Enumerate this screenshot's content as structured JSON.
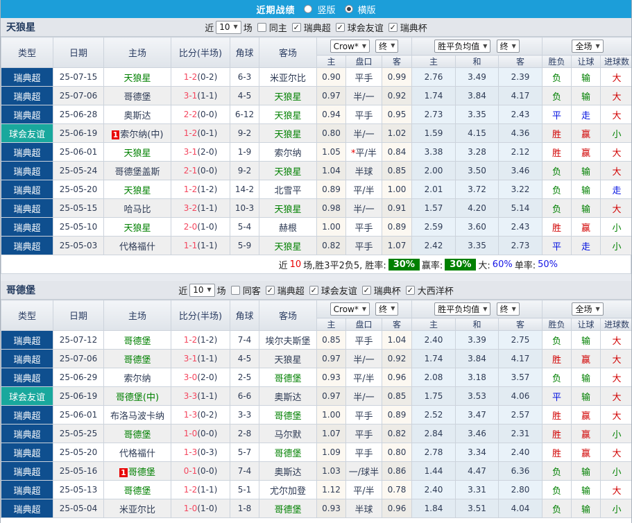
{
  "topbar": {
    "title": "近期战绩",
    "vertical_label": "竖版",
    "horizontal_label": "横版"
  },
  "icons": {
    "dropdown_arrow": "▼",
    "check": "✓"
  },
  "colors": {
    "topbar": "#1c9ed9",
    "league": "#0f4f8f",
    "friendly": "#19a89d",
    "win_red": "#d10000",
    "lose_green": "#008000",
    "draw_blue": "#0010e0",
    "score_red": "#f4465e",
    "badge_green": "#008000",
    "badge_red": "#e80000"
  },
  "sections": [
    {
      "team": "天狼星",
      "filter": {
        "near_label": "近",
        "games_value": "10",
        "games_unit": "场",
        "same_label": "同主",
        "same_checked": false,
        "leagues": [
          {
            "label": "瑞典超",
            "checked": true
          },
          {
            "label": "球会友谊",
            "checked": true
          },
          {
            "label": "瑞典杯",
            "checked": true
          }
        ]
      },
      "header": {
        "col_type": "类型",
        "col_date": "日期",
        "col_home": "主场",
        "col_score": "比分(半场)",
        "col_corner": "角球",
        "col_away": "客场",
        "odds_provider": "Crow*",
        "odds_stage": "终",
        "avg_label": "胜平负均值",
        "avg_stage": "终",
        "full_label": "全场",
        "sub": [
          "主",
          "盘口",
          "客",
          "主",
          "和",
          "客",
          "胜负",
          "让球",
          "进球数"
        ]
      },
      "rows": [
        {
          "type": "瑞典超",
          "friendly": false,
          "date": "25-07-15",
          "badge": "",
          "home": "天狼星",
          "home_hl": true,
          "score": "1-2",
          "half": "(0-2)",
          "corner": "6-3",
          "away": "米亚尔比",
          "away_hl": false,
          "odds_home": "0.90",
          "handicap": "平手",
          "star": "",
          "odds_away": "0.99",
          "avg_home": "2.76",
          "avg_draw": "3.49",
          "avg_away": "2.39",
          "outcome": "负",
          "outcome_c": "g",
          "let_result": "输",
          "let_c": "g",
          "goals": "大",
          "goals_c": "r"
        },
        {
          "type": "瑞典超",
          "friendly": false,
          "date": "25-07-06",
          "badge": "",
          "home": "哥德堡",
          "home_hl": false,
          "score": "3-1",
          "half": "(1-1)",
          "corner": "4-5",
          "away": "天狼星",
          "away_hl": true,
          "odds_home": "0.97",
          "handicap": "半/一",
          "star": "",
          "odds_away": "0.92",
          "avg_home": "1.74",
          "avg_draw": "3.84",
          "avg_away": "4.17",
          "outcome": "负",
          "outcome_c": "g",
          "let_result": "输",
          "let_c": "g",
          "goals": "大",
          "goals_c": "r"
        },
        {
          "type": "瑞典超",
          "friendly": false,
          "date": "25-06-28",
          "badge": "",
          "home": "奥斯达",
          "home_hl": false,
          "score": "2-2",
          "half": "(0-0)",
          "corner": "6-12",
          "away": "天狼星",
          "away_hl": true,
          "odds_home": "0.94",
          "handicap": "平手",
          "star": "",
          "odds_away": "0.95",
          "avg_home": "2.73",
          "avg_draw": "3.35",
          "avg_away": "2.43",
          "outcome": "平",
          "outcome_c": "b",
          "let_result": "走",
          "let_c": "b",
          "goals": "大",
          "goals_c": "r"
        },
        {
          "type": "球会友谊",
          "friendly": true,
          "date": "25-06-19",
          "badge": "1",
          "home": "索尔纳(中)",
          "home_hl": false,
          "score": "1-2",
          "half": "(0-1)",
          "corner": "9-2",
          "away": "天狼星",
          "away_hl": true,
          "odds_home": "0.80",
          "handicap": "半/一",
          "star": "",
          "odds_away": "1.02",
          "avg_home": "1.59",
          "avg_draw": "4.15",
          "avg_away": "4.36",
          "outcome": "胜",
          "outcome_c": "r",
          "let_result": "赢",
          "let_c": "r",
          "goals": "小",
          "goals_c": "g"
        },
        {
          "type": "瑞典超",
          "friendly": false,
          "date": "25-06-01",
          "badge": "",
          "home": "天狼星",
          "home_hl": true,
          "score": "3-1",
          "half": "(2-0)",
          "corner": "1-9",
          "away": "索尔纳",
          "away_hl": false,
          "odds_home": "1.05",
          "handicap": "平/半",
          "star": "*",
          "odds_away": "0.84",
          "avg_home": "3.38",
          "avg_draw": "3.28",
          "avg_away": "2.12",
          "outcome": "胜",
          "outcome_c": "r",
          "let_result": "赢",
          "let_c": "r",
          "goals": "大",
          "goals_c": "r"
        },
        {
          "type": "瑞典超",
          "friendly": false,
          "date": "25-05-24",
          "badge": "",
          "home": "哥德堡盖斯",
          "home_hl": false,
          "score": "2-1",
          "half": "(0-0)",
          "corner": "9-2",
          "away": "天狼星",
          "away_hl": true,
          "odds_home": "1.04",
          "handicap": "半球",
          "star": "",
          "odds_away": "0.85",
          "avg_home": "2.00",
          "avg_draw": "3.50",
          "avg_away": "3.46",
          "outcome": "负",
          "outcome_c": "g",
          "let_result": "输",
          "let_c": "g",
          "goals": "大",
          "goals_c": "r"
        },
        {
          "type": "瑞典超",
          "friendly": false,
          "date": "25-05-20",
          "badge": "",
          "home": "天狼星",
          "home_hl": true,
          "score": "1-2",
          "half": "(1-2)",
          "corner": "14-2",
          "away": "北雪平",
          "away_hl": false,
          "odds_home": "0.89",
          "handicap": "平/半",
          "star": "",
          "odds_away": "1.00",
          "avg_home": "2.01",
          "avg_draw": "3.72",
          "avg_away": "3.22",
          "outcome": "负",
          "outcome_c": "g",
          "let_result": "输",
          "let_c": "g",
          "goals": "走",
          "goals_c": "b"
        },
        {
          "type": "瑞典超",
          "friendly": false,
          "date": "25-05-15",
          "badge": "",
          "home": "哈马比",
          "home_hl": false,
          "score": "3-2",
          "half": "(1-1)",
          "corner": "10-3",
          "away": "天狼星",
          "away_hl": true,
          "odds_home": "0.98",
          "handicap": "半/一",
          "star": "",
          "odds_away": "0.91",
          "avg_home": "1.57",
          "avg_draw": "4.20",
          "avg_away": "5.14",
          "outcome": "负",
          "outcome_c": "g",
          "let_result": "输",
          "let_c": "g",
          "goals": "大",
          "goals_c": "r"
        },
        {
          "type": "瑞典超",
          "friendly": false,
          "date": "25-05-10",
          "badge": "",
          "home": "天狼星",
          "home_hl": true,
          "score": "2-0",
          "half": "(1-0)",
          "corner": "5-4",
          "away": "赫根",
          "away_hl": false,
          "odds_home": "1.00",
          "handicap": "平手",
          "star": "",
          "odds_away": "0.89",
          "avg_home": "2.59",
          "avg_draw": "3.60",
          "avg_away": "2.43",
          "outcome": "胜",
          "outcome_c": "r",
          "let_result": "赢",
          "let_c": "r",
          "goals": "小",
          "goals_c": "g"
        },
        {
          "type": "瑞典超",
          "friendly": false,
          "date": "25-05-03",
          "badge": "",
          "home": "代格福什",
          "home_hl": false,
          "score": "1-1",
          "half": "(1-1)",
          "corner": "5-9",
          "away": "天狼星",
          "away_hl": true,
          "odds_home": "0.82",
          "handicap": "平手",
          "star": "",
          "odds_away": "1.07",
          "avg_home": "2.42",
          "avg_draw": "3.35",
          "avg_away": "2.73",
          "outcome": "平",
          "outcome_c": "b",
          "let_result": "走",
          "let_c": "b",
          "goals": "小",
          "goals_c": "g"
        }
      ],
      "summary": {
        "prefix": "近",
        "games": "10",
        "record": "场,胜3平2负5, 胜率:",
        "win_badge": "30%",
        "profit_label": "赢率:",
        "profit_badge": "30%",
        "big_label": "大:",
        "big_value": "60%",
        "single_label": "单率:",
        "single_value": "50%"
      }
    },
    {
      "team": "哥德堡",
      "filter": {
        "near_label": "近",
        "games_value": "10",
        "games_unit": "场",
        "same_label": "同客",
        "same_checked": false,
        "leagues": [
          {
            "label": "瑞典超",
            "checked": true
          },
          {
            "label": "球会友谊",
            "checked": true
          },
          {
            "label": "瑞典杯",
            "checked": true
          },
          {
            "label": "大西洋杯",
            "checked": true
          }
        ]
      },
      "header": {
        "col_type": "类型",
        "col_date": "日期",
        "col_home": "主场",
        "col_score": "比分(半场)",
        "col_corner": "角球",
        "col_away": "客场",
        "odds_provider": "Crow*",
        "odds_stage": "终",
        "avg_label": "胜平负均值",
        "avg_stage": "终",
        "full_label": "全场",
        "sub": [
          "主",
          "盘口",
          "客",
          "主",
          "和",
          "客",
          "胜负",
          "让球",
          "进球数"
        ]
      },
      "rows": [
        {
          "type": "瑞典超",
          "friendly": false,
          "date": "25-07-12",
          "badge": "",
          "home": "哥德堡",
          "home_hl": true,
          "score": "1-2",
          "half": "(1-2)",
          "corner": "7-4",
          "away": "埃尔夫斯堡",
          "away_hl": false,
          "odds_home": "0.85",
          "handicap": "平手",
          "star": "",
          "odds_away": "1.04",
          "avg_home": "2.40",
          "avg_draw": "3.39",
          "avg_away": "2.75",
          "outcome": "负",
          "outcome_c": "g",
          "let_result": "输",
          "let_c": "g",
          "goals": "大",
          "goals_c": "r"
        },
        {
          "type": "瑞典超",
          "friendly": false,
          "date": "25-07-06",
          "badge": "",
          "home": "哥德堡",
          "home_hl": true,
          "score": "3-1",
          "half": "(1-1)",
          "corner": "4-5",
          "away": "天狼星",
          "away_hl": false,
          "odds_home": "0.97",
          "handicap": "半/一",
          "star": "",
          "odds_away": "0.92",
          "avg_home": "1.74",
          "avg_draw": "3.84",
          "avg_away": "4.17",
          "outcome": "胜",
          "outcome_c": "r",
          "let_result": "赢",
          "let_c": "r",
          "goals": "大",
          "goals_c": "r"
        },
        {
          "type": "瑞典超",
          "friendly": false,
          "date": "25-06-29",
          "badge": "",
          "home": "索尔纳",
          "home_hl": false,
          "score": "3-0",
          "half": "(2-0)",
          "corner": "2-5",
          "away": "哥德堡",
          "away_hl": true,
          "odds_home": "0.93",
          "handicap": "平/半",
          "star": "",
          "odds_away": "0.96",
          "avg_home": "2.08",
          "avg_draw": "3.18",
          "avg_away": "3.57",
          "outcome": "负",
          "outcome_c": "g",
          "let_result": "输",
          "let_c": "g",
          "goals": "大",
          "goals_c": "r"
        },
        {
          "type": "球会友谊",
          "friendly": true,
          "date": "25-06-19",
          "badge": "",
          "home": "哥德堡(中)",
          "home_hl": true,
          "score": "3-3",
          "half": "(1-1)",
          "corner": "6-6",
          "away": "奥斯达",
          "away_hl": false,
          "odds_home": "0.97",
          "handicap": "半/一",
          "star": "",
          "odds_away": "0.85",
          "avg_home": "1.75",
          "avg_draw": "3.53",
          "avg_away": "4.06",
          "outcome": "平",
          "outcome_c": "b",
          "let_result": "输",
          "let_c": "g",
          "goals": "大",
          "goals_c": "r"
        },
        {
          "type": "瑞典超",
          "friendly": false,
          "date": "25-06-01",
          "badge": "",
          "home": "布洛马波卡纳",
          "home_hl": false,
          "score": "1-3",
          "half": "(0-2)",
          "corner": "3-3",
          "away": "哥德堡",
          "away_hl": true,
          "odds_home": "1.00",
          "handicap": "平手",
          "star": "",
          "odds_away": "0.89",
          "avg_home": "2.52",
          "avg_draw": "3.47",
          "avg_away": "2.57",
          "outcome": "胜",
          "outcome_c": "r",
          "let_result": "赢",
          "let_c": "r",
          "goals": "大",
          "goals_c": "r"
        },
        {
          "type": "瑞典超",
          "friendly": false,
          "date": "25-05-25",
          "badge": "",
          "home": "哥德堡",
          "home_hl": true,
          "score": "1-0",
          "half": "(0-0)",
          "corner": "2-8",
          "away": "马尔默",
          "away_hl": false,
          "odds_home": "1.07",
          "handicap": "平手",
          "star": "",
          "odds_away": "0.82",
          "avg_home": "2.84",
          "avg_draw": "3.46",
          "avg_away": "2.31",
          "outcome": "胜",
          "outcome_c": "r",
          "let_result": "赢",
          "let_c": "r",
          "goals": "小",
          "goals_c": "g"
        },
        {
          "type": "瑞典超",
          "friendly": false,
          "date": "25-05-20",
          "badge": "",
          "home": "代格福什",
          "home_hl": false,
          "score": "1-3",
          "half": "(0-3)",
          "corner": "5-7",
          "away": "哥德堡",
          "away_hl": true,
          "odds_home": "1.09",
          "handicap": "平手",
          "star": "",
          "odds_away": "0.80",
          "avg_home": "2.78",
          "avg_draw": "3.34",
          "avg_away": "2.40",
          "outcome": "胜",
          "outcome_c": "r",
          "let_result": "赢",
          "let_c": "r",
          "goals": "大",
          "goals_c": "r"
        },
        {
          "type": "瑞典超",
          "friendly": false,
          "date": "25-05-16",
          "badge": "1",
          "home": "哥德堡",
          "home_hl": true,
          "score": "0-1",
          "half": "(0-0)",
          "corner": "7-4",
          "away": "奥斯达",
          "away_hl": false,
          "odds_home": "1.03",
          "handicap": "一/球半",
          "star": "",
          "odds_away": "0.86",
          "avg_home": "1.44",
          "avg_draw": "4.47",
          "avg_away": "6.36",
          "outcome": "负",
          "outcome_c": "g",
          "let_result": "输",
          "let_c": "g",
          "goals": "小",
          "goals_c": "g"
        },
        {
          "type": "瑞典超",
          "friendly": false,
          "date": "25-05-13",
          "badge": "",
          "home": "哥德堡",
          "home_hl": true,
          "score": "1-2",
          "half": "(1-1)",
          "corner": "5-1",
          "away": "尤尔加登",
          "away_hl": false,
          "odds_home": "1.12",
          "handicap": "平/半",
          "star": "",
          "odds_away": "0.78",
          "avg_home": "2.40",
          "avg_draw": "3.31",
          "avg_away": "2.80",
          "outcome": "负",
          "outcome_c": "g",
          "let_result": "输",
          "let_c": "g",
          "goals": "大",
          "goals_c": "r"
        },
        {
          "type": "瑞典超",
          "friendly": false,
          "date": "25-05-04",
          "badge": "",
          "home": "米亚尔比",
          "home_hl": false,
          "score": "1-0",
          "half": "(1-0)",
          "corner": "1-8",
          "away": "哥德堡",
          "away_hl": true,
          "odds_home": "0.93",
          "handicap": "半球",
          "star": "",
          "odds_away": "0.96",
          "avg_home": "1.84",
          "avg_draw": "3.51",
          "avg_away": "4.04",
          "outcome": "负",
          "outcome_c": "g",
          "let_result": "输",
          "let_c": "g",
          "goals": "小",
          "goals_c": "g"
        }
      ]
    }
  ]
}
